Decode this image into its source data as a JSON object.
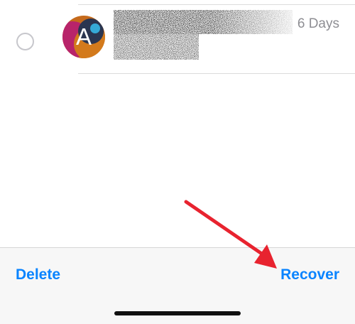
{
  "message_row": {
    "avatar_letter": "A",
    "date": "6 Days"
  },
  "toolbar": {
    "delete_label": "Delete",
    "recover_label": "Recover"
  },
  "colors": {
    "accent": "#0a84ff",
    "annotation_arrow": "#e8232f"
  }
}
